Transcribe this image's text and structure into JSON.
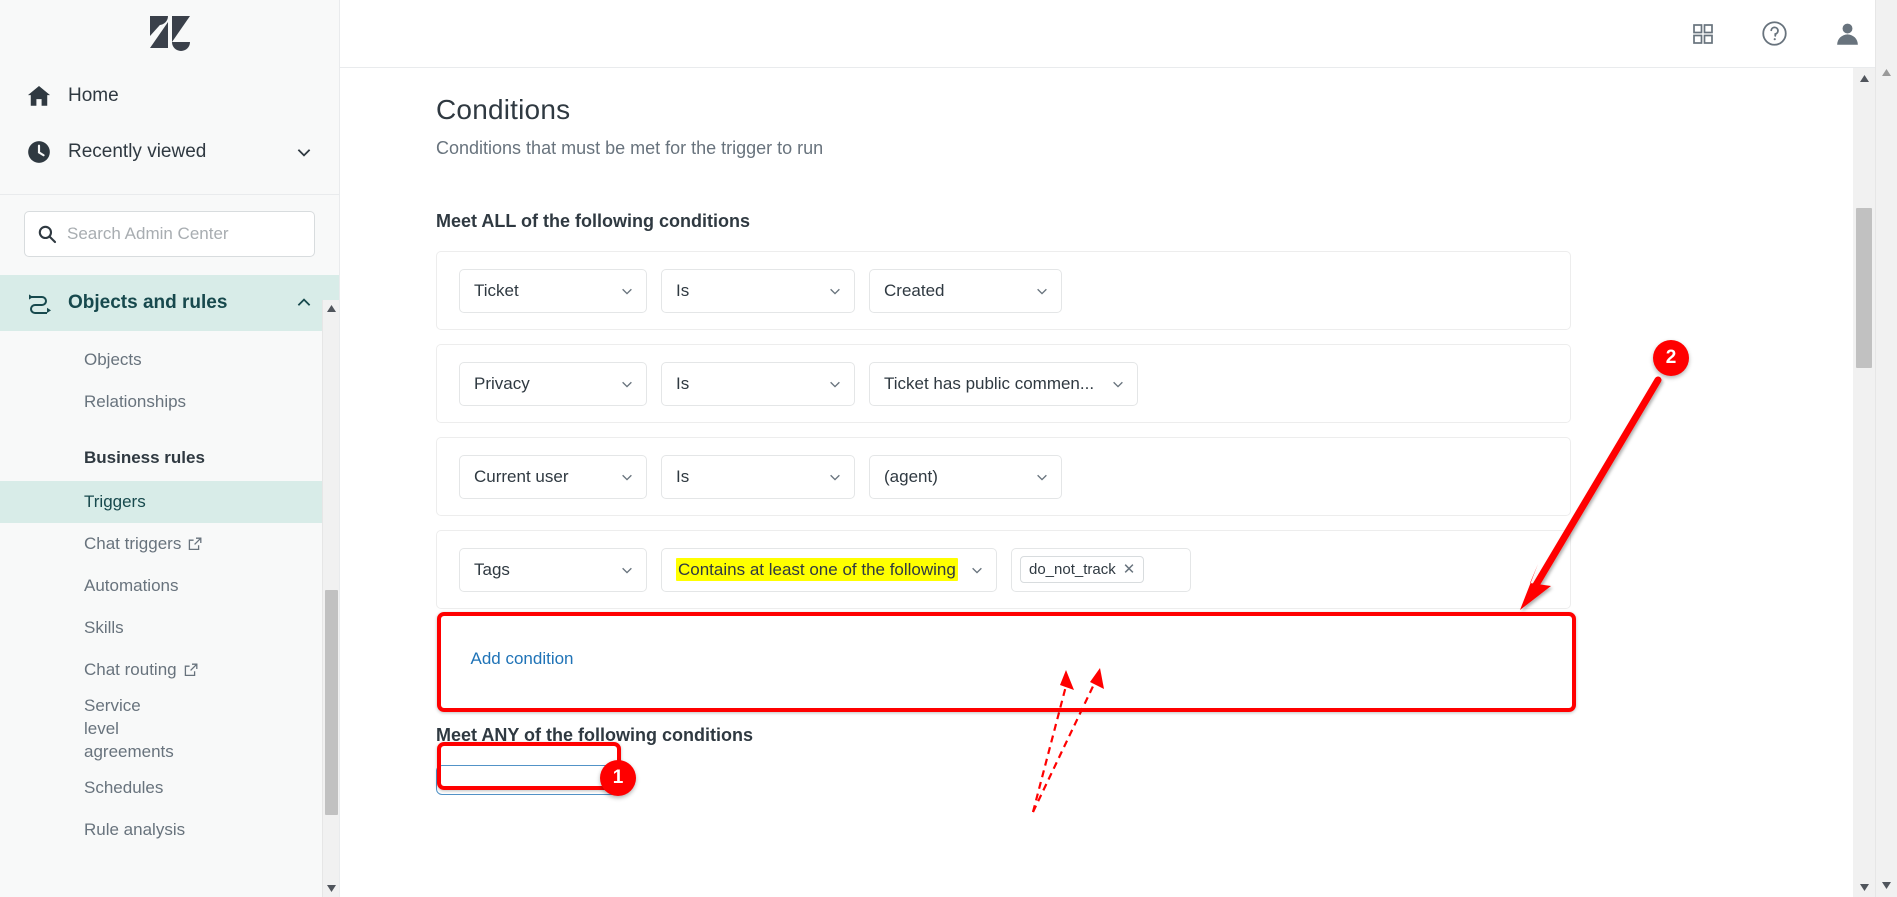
{
  "sidebar": {
    "logo_name": "zendesk-logo",
    "top_items": [
      {
        "label": "Home",
        "icon": "home-icon"
      },
      {
        "label": "Recently viewed",
        "icon": "clock-icon",
        "chevron": "chevron-down-icon"
      }
    ],
    "search": {
      "placeholder": "Search Admin Center",
      "value": "",
      "icon": "search-icon"
    },
    "section": {
      "label": "Objects and rules",
      "icon": "objects-rules-icon",
      "chevron": "chevron-up-icon"
    },
    "sub_items": [
      {
        "label": "Objects",
        "type": "link"
      },
      {
        "label": "Relationships",
        "type": "link"
      },
      {
        "label": "Business rules",
        "type": "group"
      },
      {
        "label": "Triggers",
        "type": "link",
        "active": true
      },
      {
        "label": "Chat triggers",
        "type": "link",
        "external": true
      },
      {
        "label": "Automations",
        "type": "link"
      },
      {
        "label": "Skills",
        "type": "link"
      },
      {
        "label": "Chat routing",
        "type": "link",
        "external": true
      },
      {
        "label": "Service level agreements",
        "type": "link"
      },
      {
        "label": "Schedules",
        "type": "link"
      },
      {
        "label": "Rule analysis",
        "type": "link"
      }
    ]
  },
  "topbar": {
    "icons": [
      {
        "name": "apps-grid-icon"
      },
      {
        "name": "help-question-icon"
      },
      {
        "name": "user-avatar-icon"
      }
    ]
  },
  "main": {
    "title": "Conditions",
    "subtitle": "Conditions that must be met for the trigger to run",
    "all_group_title": "Meet ALL of the following conditions",
    "any_group_title": "Meet ANY of the following conditions",
    "add_condition_label": "Add condition",
    "all_conditions": [
      {
        "field": "Ticket",
        "operator": "Is",
        "value": "Created"
      },
      {
        "field": "Privacy",
        "operator": "Is",
        "value": "Ticket has public commen..."
      },
      {
        "field": "Current user",
        "operator": "Is",
        "value": "(agent)"
      },
      {
        "field": "Tags",
        "operator": "Contains at least one of the following",
        "operator_highlighted": true,
        "value_tags": [
          "do_not_track"
        ]
      }
    ]
  },
  "annotations": {
    "accent_color": "#ff0000",
    "highlight_color": "#ffff00",
    "badges": [
      {
        "number": "1",
        "target": "add-condition-button"
      },
      {
        "number": "2",
        "target": "tags-condition-row"
      }
    ]
  }
}
